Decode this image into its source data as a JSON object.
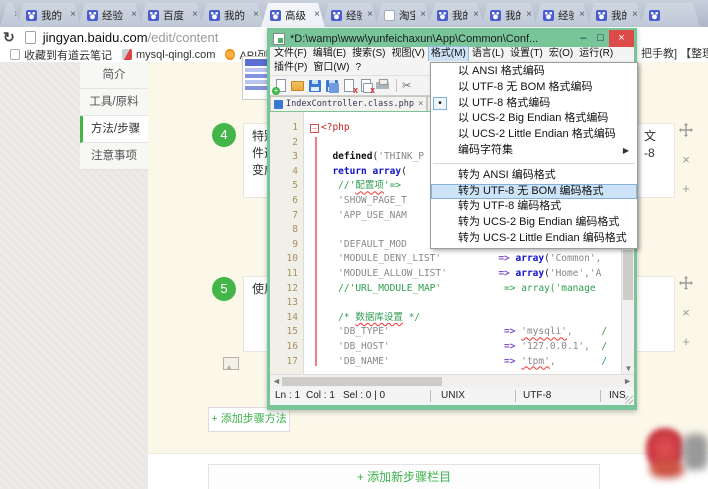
{
  "browser": {
    "tabs": [
      {
        "label": "",
        "type": "stub"
      },
      {
        "label": "我的",
        "icon": "paw"
      },
      {
        "label": "经验",
        "icon": "paw"
      },
      {
        "label": "百度",
        "icon": "paw"
      },
      {
        "label": "我的",
        "icon": "paw"
      },
      {
        "label": "高级",
        "icon": "paw",
        "active": true
      },
      {
        "label": "经验",
        "icon": "paw"
      },
      {
        "label": "淘宝",
        "icon": "page"
      },
      {
        "label": "我的",
        "icon": "paw"
      },
      {
        "label": "我的",
        "icon": "paw"
      },
      {
        "label": "经验",
        "icon": "paw"
      },
      {
        "label": "我的",
        "icon": "paw"
      },
      {
        "label": "",
        "icon": "paw",
        "type": "partial"
      }
    ],
    "url_host": "jingyan.baidu.com",
    "url_path": "/edit/content",
    "bookmarks": [
      {
        "icon": "page",
        "label": "收藏到有道云笔记"
      },
      {
        "icon": "pma",
        "label": "mysql-qingl.com"
      },
      {
        "icon": "api",
        "label": "API列表 - 腾讯开"
      }
    ],
    "bookmarks_right_fragment": "把手教] 【整理—"
  },
  "page": {
    "sidebar": {
      "items": [
        "简介",
        "工具/原料",
        "方法/步骤",
        "注意事项"
      ],
      "active_index": 2
    },
    "steps": [
      {
        "num": "4",
        "left_fragment": "特别\n件选\n变成",
        "right_fragment": "文\n-8"
      },
      {
        "num": "5",
        "left_fragment": "使用",
        "right_fragment": ""
      }
    ],
    "add_step_label": "+ 添加步骤方法",
    "add_section_label": "+ 添加新步骤栏目",
    "accent_green": "#44b549"
  },
  "editor": {
    "title": "*D:\\wamp\\www\\yunfeichaxun\\App\\Common\\Conf...",
    "window_buttons": [
      "–",
      "□",
      "×"
    ],
    "menus_row1": [
      "文件(F)",
      "编辑(E)",
      "搜索(S)",
      "视图(V)",
      "格式(M)",
      "语言(L)",
      "设置(T)",
      "宏(O)",
      "运行(R)"
    ],
    "active_menu": "格式(M)",
    "menus_row2": [
      "插件(P)",
      "窗口(W)",
      "?"
    ],
    "toolbar_icons": [
      "new-file",
      "open-folder",
      "save",
      "save-all",
      "close-doc",
      "close-all",
      "print",
      "separator",
      "cut"
    ],
    "doc_tab": "IndexController.class.php",
    "encoding_menu": [
      {
        "label": "以 ANSI 格式编码"
      },
      {
        "label": "以 UTF-8 无 BOM 格式编码"
      },
      {
        "label": "以 UTF-8 格式编码",
        "radio": true
      },
      {
        "label": "以 UCS-2 Big Endian 格式编码"
      },
      {
        "label": "以 UCS-2 Little Endian 格式编码"
      },
      {
        "label": "编码字符集",
        "submenu": true
      },
      {
        "separator": true
      },
      {
        "label": "转为 ANSI 编码格式"
      },
      {
        "label": "转为 UTF-8 无 BOM 编码格式",
        "highlight": true
      },
      {
        "label": "转为 UTF-8 编码格式"
      },
      {
        "label": "转为 UCS-2 Big Endian 编码格式"
      },
      {
        "label": "转为 UCS-2 Little Endian 编码格式"
      }
    ],
    "code_lines": [
      {
        "n": 1,
        "segs": [
          [
            "t",
            "<?php"
          ]
        ]
      },
      {
        "n": 2,
        "segs": []
      },
      {
        "n": 3,
        "segs": [
          [
            "p",
            "  "
          ],
          [
            "b",
            "defined"
          ],
          [
            "p",
            "("
          ],
          [
            "s",
            "'THINK_P"
          ]
        ]
      },
      {
        "n": 4,
        "segs": [
          [
            "p",
            "  "
          ],
          [
            "k",
            "return array"
          ],
          [
            "p",
            "("
          ]
        ]
      },
      {
        "n": 5,
        "segs": [
          [
            "p",
            "   "
          ],
          [
            "c",
            "//'"
          ],
          [
            "c sq",
            "配置项"
          ],
          [
            "c",
            "'=>"
          ]
        ]
      },
      {
        "n": 6,
        "segs": [
          [
            "p",
            "   "
          ],
          [
            "s",
            "'SHOW_PAGE_T"
          ]
        ]
      },
      {
        "n": 7,
        "segs": [
          [
            "p",
            "   "
          ],
          [
            "s",
            "'APP_USE_NAM"
          ]
        ]
      },
      {
        "n": 8,
        "segs": []
      },
      {
        "n": 9,
        "segs": [
          [
            "p",
            "   "
          ],
          [
            "s",
            "'DEFAULT_MOD"
          ]
        ]
      },
      {
        "n": 10,
        "segs": [
          [
            "p",
            "   "
          ],
          [
            "s",
            "'MODULE_DENY_LIST'"
          ],
          [
            "p",
            "          "
          ],
          [
            "o",
            "=>"
          ],
          [
            "p",
            " "
          ],
          [
            "k",
            "array"
          ],
          [
            "p",
            "("
          ],
          [
            "s",
            "'Common',"
          ]
        ]
      },
      {
        "n": 11,
        "segs": [
          [
            "p",
            "   "
          ],
          [
            "s",
            "'MODULE_ALLOW_LIST'"
          ],
          [
            "p",
            "         "
          ],
          [
            "o",
            "=>"
          ],
          [
            "p",
            " "
          ],
          [
            "k",
            "array"
          ],
          [
            "p",
            "("
          ],
          [
            "s",
            "'Home','A"
          ]
        ]
      },
      {
        "n": 12,
        "segs": [
          [
            "p",
            "   "
          ],
          [
            "c",
            "//'URL_MODULE_MAP'           => array('manage"
          ]
        ]
      },
      {
        "n": 13,
        "segs": []
      },
      {
        "n": 14,
        "segs": [
          [
            "p",
            "   "
          ],
          [
            "c",
            "/* "
          ],
          [
            "c sq",
            "数据库设置"
          ],
          [
            "c",
            " */"
          ]
        ]
      },
      {
        "n": 15,
        "segs": [
          [
            "p",
            "   "
          ],
          [
            "s",
            "'DB_TYPE'"
          ],
          [
            "p",
            "                    "
          ],
          [
            "o",
            "=>"
          ],
          [
            "p",
            " "
          ],
          [
            "s sq",
            "'mysqli'"
          ],
          [
            "s",
            ","
          ],
          [
            "p",
            "     "
          ],
          [
            "c",
            "/"
          ]
        ]
      },
      {
        "n": 16,
        "segs": [
          [
            "p",
            "   "
          ],
          [
            "s",
            "'DB_HOST'"
          ],
          [
            "p",
            "                    "
          ],
          [
            "o",
            "=>"
          ],
          [
            "p",
            " "
          ],
          [
            "s",
            "'127.0.0.1',"
          ],
          [
            "p",
            "  "
          ],
          [
            "c",
            "/"
          ]
        ]
      },
      {
        "n": 17,
        "segs": [
          [
            "p",
            "   "
          ],
          [
            "s",
            "'DB_NAME'"
          ],
          [
            "p",
            "                    "
          ],
          [
            "o",
            "=>"
          ],
          [
            "p",
            " "
          ],
          [
            "s sq",
            "'tpm'"
          ],
          [
            "s",
            ","
          ],
          [
            "p",
            "        "
          ],
          [
            "c",
            "/"
          ]
        ]
      }
    ],
    "status": {
      "ln": "Ln : 1",
      "col": "Col : 1",
      "sel": "Sel : 0 | 0",
      "eol": "UNIX",
      "encoding": "UTF-8",
      "mode": "INS"
    }
  }
}
